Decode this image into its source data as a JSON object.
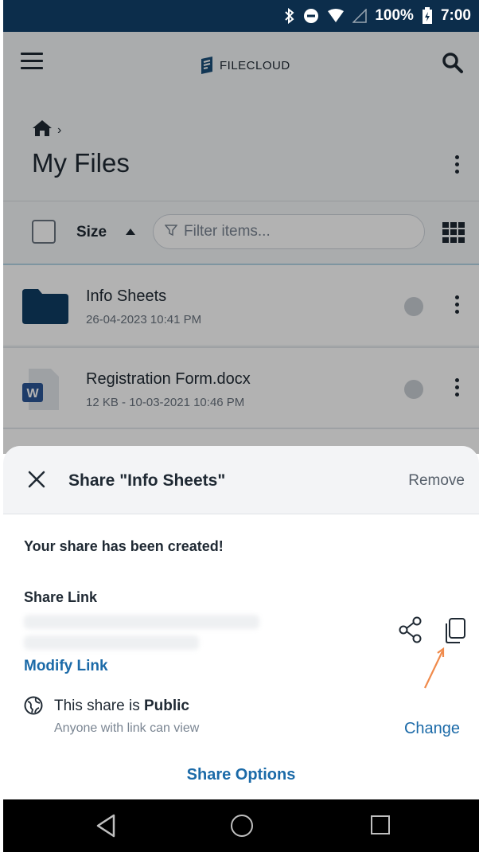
{
  "status_bar": {
    "battery": "100%",
    "time": "7:00",
    "icons": [
      "bluetooth-icon",
      "dnd-icon",
      "wifi-icon",
      "signal-icon",
      "battery-charging-icon"
    ]
  },
  "header": {
    "logo_text": "FILECLOUD",
    "menu_icon": "hamburger-icon",
    "search_icon": "search-icon"
  },
  "breadcrumb": {
    "separator": "›",
    "home_icon": "home-icon"
  },
  "page": {
    "title": "My Files"
  },
  "toolbar": {
    "sort_label": "Size",
    "filter_placeholder": "Filter items..."
  },
  "files": [
    {
      "name": "Info Sheets",
      "meta": "26-04-2023 10:41 PM",
      "icon": "folder-icon"
    },
    {
      "name": "Registration Form.docx",
      "meta": "12 KB - 10-03-2021 10:46 PM",
      "icon": "word-doc-icon"
    }
  ],
  "share_sheet": {
    "title": "Share \"Info Sheets\"",
    "remove_label": "Remove",
    "created_message": "Your share has been created!",
    "link_label": "Share Link",
    "modify_link_label": "Modify Link",
    "public_prefix": "This share is ",
    "public_word": "Public",
    "public_sub": "Anyone with link can view",
    "change_label": "Change",
    "options_label": "Share Options"
  },
  "colors": {
    "status_bar": "#0c2d4b",
    "accent": "#1b6aa8",
    "folder": "#0f3d63",
    "word": "#2b5797"
  }
}
